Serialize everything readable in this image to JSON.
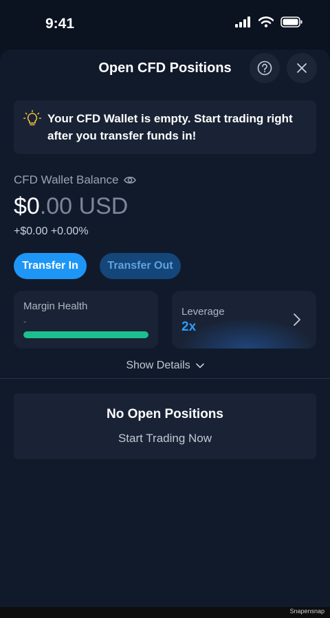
{
  "status_bar": {
    "time": "9:41"
  },
  "header": {
    "title": "Open CFD Positions"
  },
  "notice": {
    "text": "Your CFD Wallet is empty. Start trading right after you transfer funds in!"
  },
  "balance": {
    "label": "CFD Wallet Balance",
    "amount_whole": "$0",
    "amount_rest": ".00 USD",
    "change": "+$0.00 +0.00%"
  },
  "actions": {
    "transfer_in": "Transfer In",
    "transfer_out": "Transfer Out"
  },
  "margin": {
    "label": "Margin Health",
    "value": "-",
    "health_fraction": 1.0
  },
  "leverage": {
    "label": "Leverage",
    "value": "2x"
  },
  "details": {
    "label": "Show Details"
  },
  "positions": {
    "empty_title": "No Open Positions",
    "cta": "Start Trading Now"
  },
  "watermark": "Snapensnap",
  "colors": {
    "accent": "#1e96f5",
    "health": "#1cc08f",
    "leverage": "#2f9bff",
    "background": "#111a2b"
  },
  "icons": [
    "signal-icon",
    "wifi-icon",
    "battery-icon",
    "help-icon",
    "close-icon",
    "lightbulb-icon",
    "eye-icon",
    "chevron-right-icon",
    "chevron-down-icon"
  ]
}
